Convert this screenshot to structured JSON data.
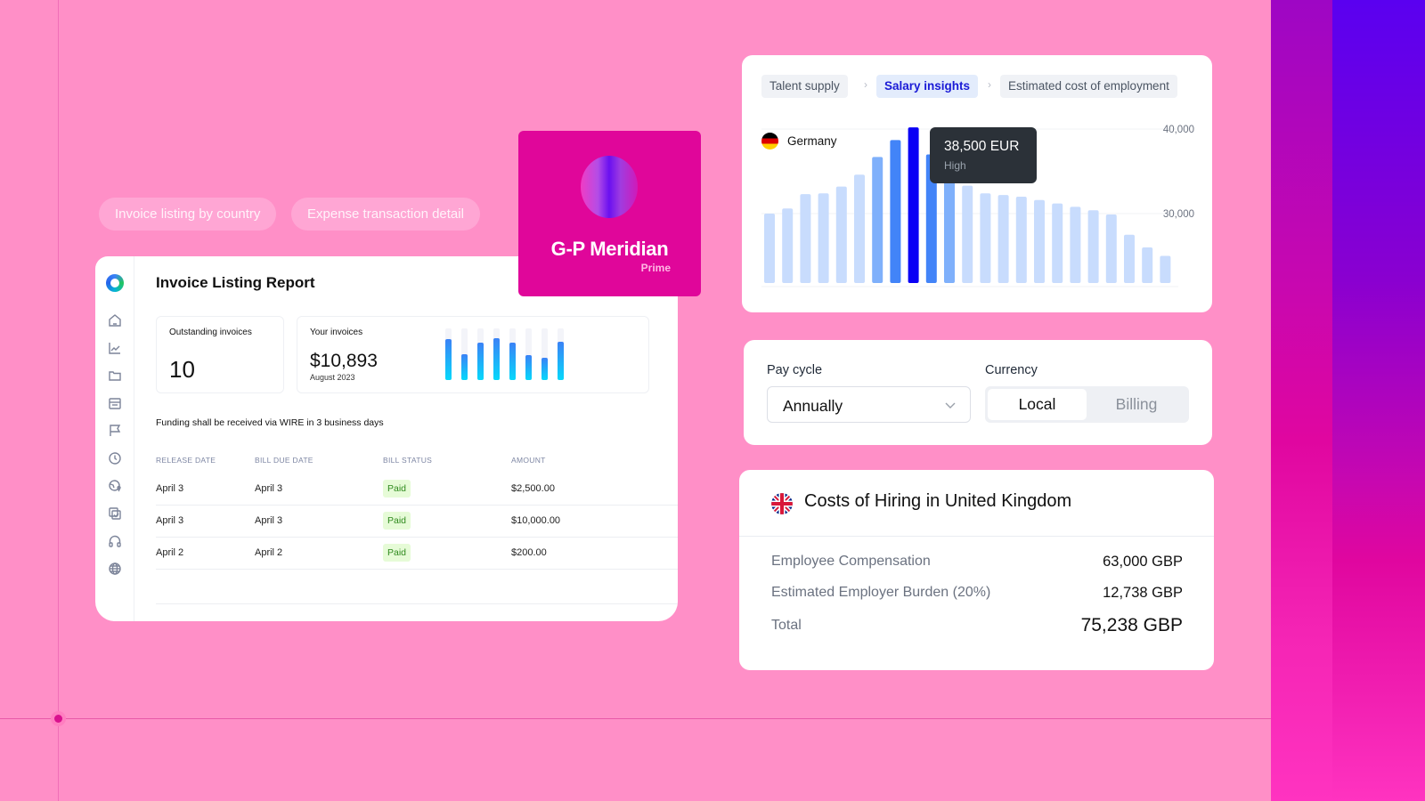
{
  "colors": {
    "background": "#ff8fc7",
    "brand_magenta": "#e0069a",
    "accent_blue": "#1a1ad6",
    "paid_green": "#2f8a1e"
  },
  "pills": [
    {
      "label": "Invoice listing by country"
    },
    {
      "label": "Expense transaction detail"
    }
  ],
  "invoice": {
    "title": "Invoice Listing Report",
    "sidebar_icons": [
      "home-icon",
      "chart-line-icon",
      "folder-icon",
      "store-icon",
      "flag-icon",
      "clock-icon",
      "globe-pin-icon",
      "copy-check-icon",
      "headphones-icon",
      "globe-icon"
    ],
    "outstanding": {
      "label": "Outstanding invoices",
      "value": "10"
    },
    "your_invoices": {
      "label": "Your invoices",
      "amount": "$10,893",
      "period": "August 2023"
    },
    "mini_chart_fill": [
      0.79,
      0.5,
      0.72,
      0.81,
      0.72,
      0.48,
      0.43,
      0.75
    ],
    "funding_note": "Funding shall be received via WIRE in 3 business days",
    "table": {
      "headers": [
        "RELEASE DATE",
        "BILL DUE DATE",
        "BILL STATUS",
        "AMOUNT"
      ],
      "rows": [
        {
          "release": "April 3",
          "due": "April 3",
          "status": "Paid",
          "amount": "$2,500.00"
        },
        {
          "release": "April 3",
          "due": "April 3",
          "status": "Paid",
          "amount": "$10,000.00"
        },
        {
          "release": "April 2",
          "due": "April 2",
          "status": "Paid",
          "amount": "$200.00"
        }
      ]
    }
  },
  "brand": {
    "name": "G-P Meridian",
    "tier": "Prime"
  },
  "salary": {
    "breadcrumbs": [
      {
        "label": "Talent supply",
        "active": false
      },
      {
        "label": "Salary insights",
        "active": true
      },
      {
        "label": "Estimated cost of employment",
        "active": false
      }
    ],
    "country": "Germany",
    "tooltip": {
      "value": "38,500 EUR",
      "label": "High"
    }
  },
  "chart_data": {
    "type": "bar",
    "title": "Salary insights – Germany",
    "xlabel": "",
    "ylabel": "EUR",
    "ylim": [
      21800,
      41000
    ],
    "yticks": [
      {
        "value": 40000,
        "label": "40,000"
      },
      {
        "value": 30000,
        "label": "30,000"
      }
    ],
    "grid": true,
    "values": [
      30000,
      30600,
      32300,
      32400,
      33200,
      34600,
      36700,
      38700,
      40200,
      37000,
      35400,
      33300,
      32400,
      32200,
      32000,
      31600,
      31200,
      30800,
      30400,
      29900,
      27500,
      26000,
      25000
    ],
    "highlight_index": 8,
    "bar_tiers": [
      0,
      0,
      0,
      0,
      0,
      0,
      1,
      2,
      3,
      2,
      1,
      0,
      0,
      0,
      0,
      0,
      0,
      0,
      0,
      0,
      0,
      0,
      0
    ],
    "tier_colors": [
      "#c8dcfd",
      "#7fb0fb",
      "#4284f8",
      "#0a00f5"
    ]
  },
  "settings": {
    "pay_cycle": {
      "label": "Pay cycle",
      "value": "Annually"
    },
    "currency": {
      "label": "Currency",
      "options": [
        "Local",
        "Billing"
      ],
      "selected": "Local"
    }
  },
  "costs": {
    "title": "Costs of Hiring in United Kingdom",
    "rows": [
      {
        "label": "Employee Compensation",
        "value": "63,000 GBP"
      },
      {
        "label": "Estimated Employer Burden (20%)",
        "value": "12,738 GBP"
      },
      {
        "label": "Total",
        "value": "75,238 GBP"
      }
    ]
  }
}
